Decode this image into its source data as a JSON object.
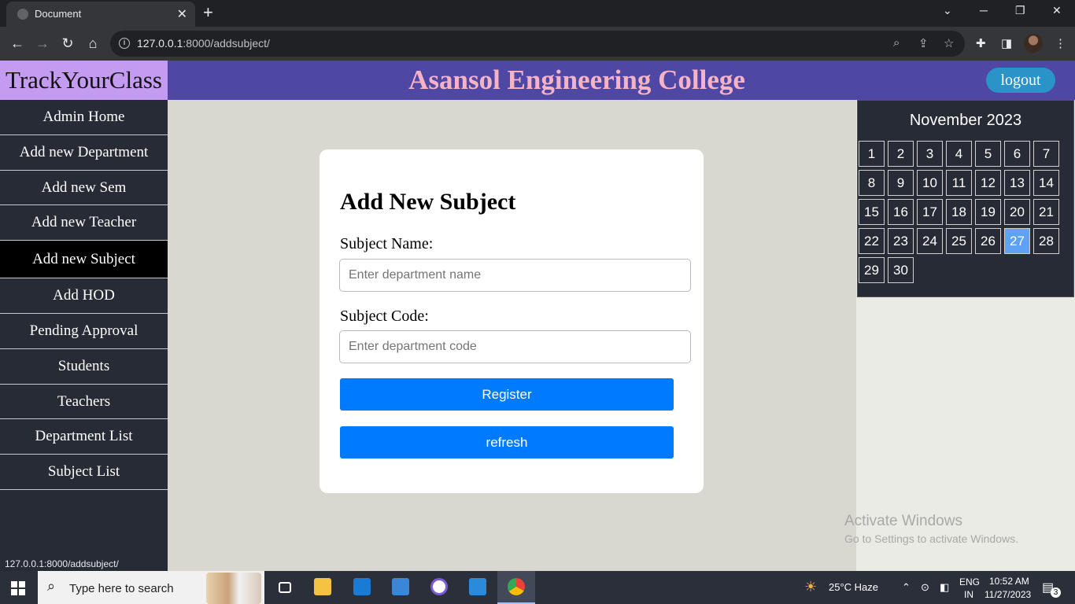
{
  "browser": {
    "tab_title": "Document",
    "tab_close": "✕",
    "new_tab": "+",
    "url_host": "127.0.0.1",
    "url_path": ":8000/addsubject/",
    "status_url": "127.0.0.1:8000/addsubject/"
  },
  "app": {
    "brand": "TrackYourClass",
    "college": "Asansol Engineering College",
    "logout": "logout"
  },
  "sidebar": {
    "items": [
      {
        "label": "Admin Home"
      },
      {
        "label": "Add new Department"
      },
      {
        "label": "Add new Sem"
      },
      {
        "label": "Add new Teacher"
      },
      {
        "label": "Add new Subject",
        "active": true
      },
      {
        "label": "Add HOD"
      },
      {
        "label": "Pending Approval"
      },
      {
        "label": "Students"
      },
      {
        "label": "Teachers"
      },
      {
        "label": "Department List"
      },
      {
        "label": "Subject List"
      }
    ]
  },
  "form": {
    "title": "Add New Subject",
    "name_label": "Subject Name:",
    "name_placeholder": "Enter department name",
    "code_label": "Subject Code:",
    "code_placeholder": "Enter department code",
    "register_label": "Register",
    "refresh_label": "refresh"
  },
  "calendar": {
    "title": "November 2023",
    "days": [
      "1",
      "2",
      "3",
      "4",
      "5",
      "6",
      "7",
      "8",
      "9",
      "10",
      "11",
      "12",
      "13",
      "14",
      "15",
      "16",
      "17",
      "18",
      "19",
      "20",
      "21",
      "22",
      "23",
      "24",
      "25",
      "26",
      "27",
      "28",
      "29",
      "30"
    ],
    "today": "27",
    "today_color": "#5da2f5"
  },
  "watermark": {
    "line1": "Activate Windows",
    "line2": "Go to Settings to activate Windows."
  },
  "taskbar": {
    "search_placeholder": "Type here to search",
    "weather": "25°C  Haze",
    "lang_top": "ENG",
    "lang_bottom": "IN",
    "time": "10:52 AM",
    "date": "11/27/2023",
    "notification_count": "3"
  },
  "colors": {
    "brand_bg": "#c39bf0",
    "header_bg": "#4e47a3",
    "college_text": "#f7b3c6",
    "button_blue": "#007bff",
    "sidebar_bg": "#272b35"
  }
}
